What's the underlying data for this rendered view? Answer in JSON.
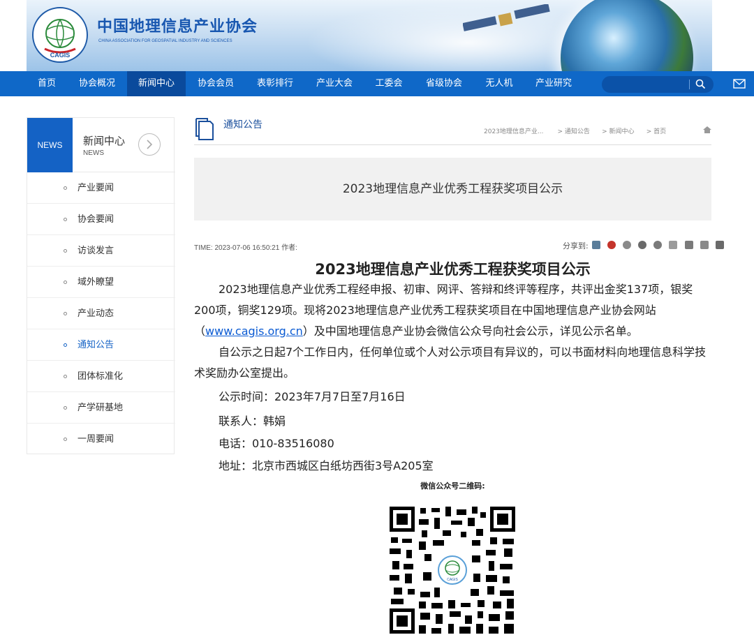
{
  "header": {
    "logo_cn": "中国地理信息产业协会",
    "logo_en": "CHINA ASSOCIATION FOR GEOSPATIAL INDUSTRY AND SCIENCES",
    "logo_mark": "CAGIS"
  },
  "nav": {
    "items": [
      "首页",
      "协会概况",
      "新闻中心",
      "协会会员",
      "表彰排行",
      "产业大会",
      "工委会",
      "省级协会",
      "无人机",
      "产业研究"
    ],
    "active": "新闻中心",
    "search_icon": "search-icon",
    "mail_icon": "mail-icon"
  },
  "sidebar": {
    "badge": "NEWS",
    "title": "新闻中心",
    "subtitle": "NEWS",
    "items": [
      "产业要闻",
      "协会要闻",
      "访谈发言",
      "域外瞭望",
      "产业动态",
      "通知公告",
      "团体标准化",
      "产学研基地",
      "一周要闻"
    ],
    "active": "通知公告"
  },
  "section": {
    "title": "通知公告",
    "breadcrumb": [
      "2023地理信息产业...",
      "> 通知公告",
      "> 新闻中心",
      "> 首页"
    ]
  },
  "article": {
    "box_title": "2023地理信息产业优秀工程获奖项目公示",
    "meta": "TIME: 2023-07-06 16:50:21 作者:",
    "share_label": "分享到:",
    "title": "2023地理信息产业优秀工程获奖项目公示",
    "p1_a": "2023地理信息产业优秀工程经申报、初审、网评、答辩和终评等程序，共评出金奖137项，银奖200项，铜奖129项。现将2023地理信息产业优秀工程获奖项目在中国地理信息产业协会网站（",
    "p1_link": "www.cagis.org.cn",
    "p1_b": "）及中国地理信息产业协会微信公众号向社会公示，详见公示名单。",
    "p2": "自公示之日起7个工作日内，任何单位或个人对公示项目有异议的，可以书面材料向地理信息科学技术奖励办公室提出。",
    "time": "公示时间：2023年7月7日至7月16日",
    "contact": "联系人：韩娟",
    "phone": "电话：010-83516080",
    "address": "地址：北京市西城区白纸坊西街3号A205室",
    "qr_label": "微信公众号二维码:"
  },
  "colors": {
    "nav_bg": "#0f68c8",
    "nav_active": "#0a4a9c",
    "accent": "#1462c5",
    "link": "#0b5bd3"
  }
}
